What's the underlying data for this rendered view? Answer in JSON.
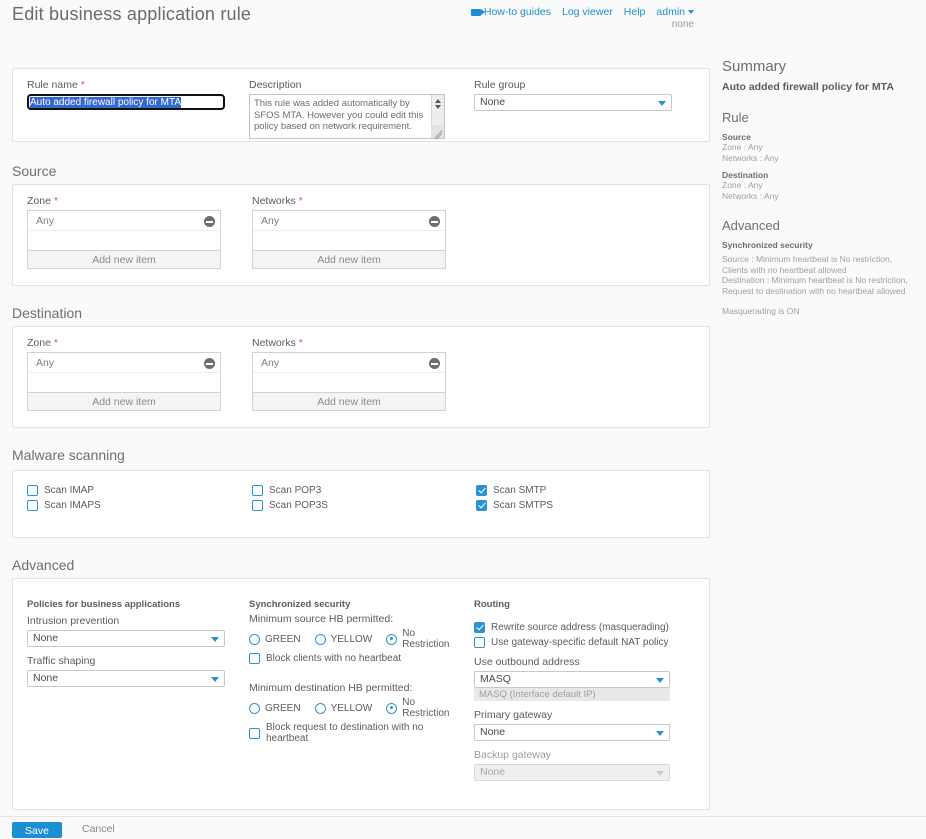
{
  "header": {
    "title": "Edit business application rule",
    "nav": [
      {
        "label": "How-to guides",
        "icon": "video-icon"
      },
      {
        "label": "Log viewer"
      },
      {
        "label": "Help"
      },
      {
        "label": "admin"
      }
    ],
    "admin_sub": "none"
  },
  "general": {
    "rule_name_label": "Rule name",
    "rule_name_value": "Auto added firewall policy for MTA",
    "description_label": "Description",
    "description_value": "This rule was added automatically by SFOS MTA. However you could edit this policy based on network requirement.",
    "rule_group_label": "Rule group",
    "rule_group_value": "None"
  },
  "source": {
    "title": "Source",
    "zone_label": "Zone",
    "zone_items": [
      "Any"
    ],
    "networks_label": "Networks",
    "networks_items": [
      "Any"
    ],
    "add_label": "Add new item"
  },
  "destination": {
    "title": "Destination",
    "zone_label": "Zone",
    "zone_items": [
      "Any"
    ],
    "networks_label": "Networks",
    "networks_items": [
      "Any"
    ],
    "add_label": "Add new item"
  },
  "malware": {
    "title": "Malware scanning",
    "col1": [
      {
        "label": "Scan IMAP",
        "checked": false
      },
      {
        "label": "Scan IMAPS",
        "checked": false
      }
    ],
    "col2": [
      {
        "label": "Scan POP3",
        "checked": false
      },
      {
        "label": "Scan POP3S",
        "checked": false
      }
    ],
    "col3": [
      {
        "label": "Scan SMTP",
        "checked": true
      },
      {
        "label": "Scan SMTPS",
        "checked": true
      }
    ]
  },
  "advanced": {
    "title": "Advanced",
    "policies": {
      "group_label": "Policies for business applications",
      "intrusion_label": "Intrusion prevention",
      "intrusion_value": "None",
      "traffic_label": "Traffic shaping",
      "traffic_value": "None"
    },
    "sync_security": {
      "group_label": "Synchronized security",
      "source_label": "Minimum source HB permitted:",
      "source_options": [
        {
          "label": "GREEN",
          "selected": false
        },
        {
          "label": "YELLOW",
          "selected": false
        },
        {
          "label": "No Restriction",
          "selected": true
        }
      ],
      "source_block_label": "Block clients with no heartbeat",
      "source_block_checked": false,
      "dest_label": "Minimum destination HB permitted:",
      "dest_options": [
        {
          "label": "GREEN",
          "selected": false
        },
        {
          "label": "YELLOW",
          "selected": false
        },
        {
          "label": "No Restriction",
          "selected": true
        }
      ],
      "dest_block_label": "Block request to destination with no heartbeat",
      "dest_block_checked": false
    },
    "routing": {
      "group_label": "Routing",
      "masquerade_label": "Rewrite source address (masquerading)",
      "masquerade_checked": true,
      "gateway_nat_label": "Use gateway-specific default NAT policy",
      "gateway_nat_checked": false,
      "outbound_label": "Use outbound address",
      "outbound_value": "MASQ",
      "outbound_hint": "MASQ (Interface default IP)",
      "primary_gateway_label": "Primary gateway",
      "primary_gateway_value": "None",
      "backup_gateway_label": "Backup gateway",
      "backup_gateway_value": "None"
    }
  },
  "summary": {
    "title": "Summary",
    "subtitle": "Auto added firewall policy for MTA",
    "rule_heading": "Rule",
    "source_key": "Source",
    "source_zone": "Zone : Any",
    "source_networks": "Networks : Any",
    "destination_key": "Destination",
    "destination_zone": "Zone : Any",
    "destination_networks": "Networks : Any",
    "advanced_heading": "Advanced",
    "sync_key": "Synchronized security",
    "sync_source": "Source : Minimum heartbeat is No restriction, Clients with no heartbeat allowed",
    "sync_destination": "Destination : Minimum heartbeat is No restriction, Request to destination with no heartbeat allowed",
    "masquerading": "Masquerading is ON"
  },
  "footer": {
    "save_label": "Save",
    "cancel_label": "Cancel"
  }
}
